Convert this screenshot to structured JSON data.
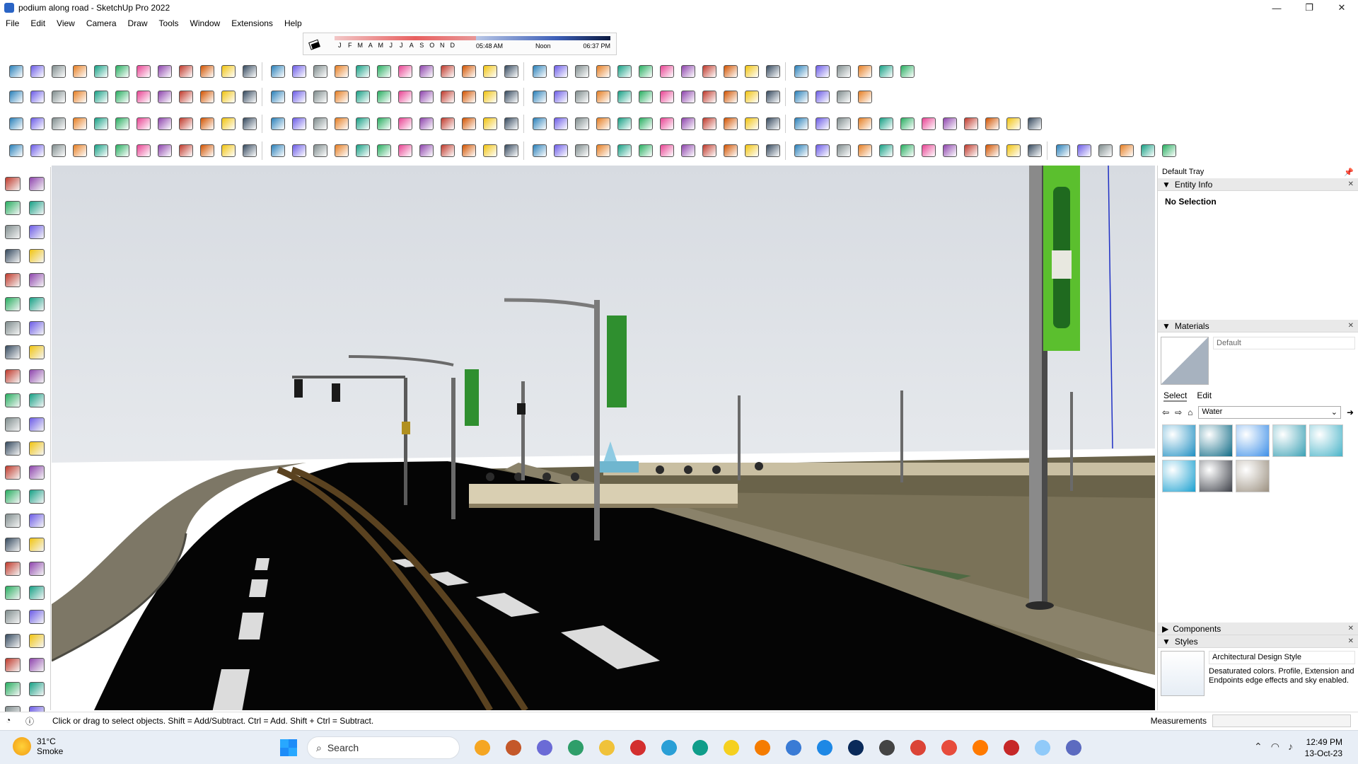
{
  "window": {
    "title": "podium along road - SketchUp Pro 2022",
    "controls": [
      "—",
      "❐",
      "✕"
    ]
  },
  "menu": [
    "File",
    "Edit",
    "View",
    "Camera",
    "Draw",
    "Tools",
    "Window",
    "Extensions",
    "Help"
  ],
  "shadows": {
    "months": [
      "J",
      "F",
      "M",
      "A",
      "M",
      "J",
      "J",
      "A",
      "S",
      "O",
      "N",
      "D"
    ],
    "sunrise": "05:48 AM",
    "noon": "Noon",
    "sunset": "06:37 PM"
  },
  "tray": {
    "title": "Default Tray",
    "entity_info": {
      "label": "Entity Info",
      "selection": "No Selection"
    },
    "materials": {
      "label": "Materials",
      "name": "Default",
      "tabs": [
        "Select",
        "Edit"
      ],
      "collection": "Water",
      "swatches": [
        "#1f8fc2",
        "#0f6b86",
        "#3d8fe8",
        "#3aa0b4",
        "#48b3c8",
        "#1aa0d0",
        "#3d4048",
        "#9b9080"
      ]
    },
    "components": {
      "label": "Components"
    },
    "styles": {
      "label": "Styles",
      "name": "Architectural Design Style",
      "description": "Desaturated colors. Profile, Extension and Endpoints edge effects and sky enabled."
    }
  },
  "status": {
    "hint": "Click or drag to select objects. Shift = Add/Subtract. Ctrl = Add. Shift + Ctrl = Subtract.",
    "measurements_label": "Measurements"
  },
  "taskbar": {
    "temperature": "31°C",
    "weather": "Smoke",
    "search_placeholder": "Search",
    "time": "12:49 PM",
    "date": "13-Oct-23"
  },
  "colors": {
    "accent": "#1a73e8",
    "sky_top": "#d9dde2",
    "road": "#060606"
  }
}
